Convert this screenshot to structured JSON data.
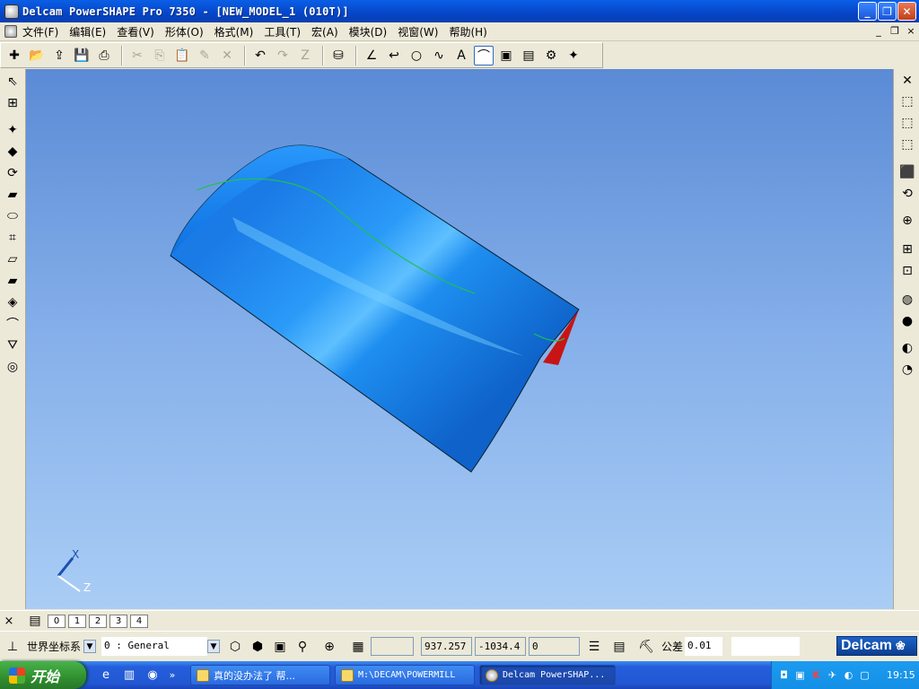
{
  "window": {
    "title": "Delcam PowerSHAPE Pro 7350 - [NEW_MODEL_1 (010T)]",
    "minimize_glyph": "_",
    "maximize_glyph": "❐",
    "close_glyph": "✕"
  },
  "menu": {
    "items": [
      "文件(F)",
      "编辑(E)",
      "查看(V)",
      "形体(O)",
      "格式(M)",
      "工具(T)",
      "宏(A)",
      "模块(D)",
      "视窗(W)",
      "帮助(H)"
    ],
    "mdi_minimize": "_",
    "mdi_restore": "❐",
    "mdi_close": "×"
  },
  "toolbar": {
    "buttons": [
      {
        "icon": "new-icon",
        "glyph": "✚"
      },
      {
        "icon": "open-icon",
        "glyph": "📂"
      },
      {
        "icon": "import-icon",
        "glyph": "⇪"
      },
      {
        "icon": "save-icon",
        "glyph": "💾"
      },
      {
        "icon": "print-icon",
        "glyph": "⎙"
      },
      {
        "icon": "cut-icon",
        "glyph": "✂",
        "dim": true
      },
      {
        "icon": "copy-icon",
        "glyph": "⎘",
        "dim": true
      },
      {
        "icon": "paste-icon",
        "glyph": "📋",
        "dim": true
      },
      {
        "icon": "delete-icon",
        "glyph": "✎",
        "dim": true
      },
      {
        "icon": "clear-icon",
        "glyph": "✕",
        "dim": true
      },
      {
        "icon": "undo-icon",
        "glyph": "↶"
      },
      {
        "icon": "redo-icon",
        "glyph": "↷",
        "dim": true
      },
      {
        "icon": "sketch-icon",
        "glyph": "Z",
        "dim": true
      },
      {
        "icon": "selection-icon",
        "glyph": "⛁"
      },
      {
        "icon": "line-icon",
        "glyph": "∠"
      },
      {
        "icon": "arc-icon",
        "glyph": "↩"
      },
      {
        "icon": "circle-icon",
        "glyph": "○"
      },
      {
        "icon": "curve-icon",
        "glyph": "∿"
      },
      {
        "icon": "text-icon",
        "glyph": "A"
      },
      {
        "icon": "surface-icon",
        "glyph": "⌒",
        "active": true
      },
      {
        "icon": "solid-icon",
        "glyph": "▣"
      },
      {
        "icon": "layers-icon",
        "glyph": "▤"
      },
      {
        "icon": "settings-icon",
        "glyph": "⚙"
      },
      {
        "icon": "wizard-icon",
        "glyph": "✦"
      }
    ]
  },
  "left_tools": [
    "select-icon",
    "multi-select-icon",
    "point-icon",
    "plane-icon",
    "arc-tool-icon",
    "surface-tool-icon",
    "ellipse-icon",
    "mesh-icon",
    "extrude-icon",
    "prism-icon",
    "rotate-icon",
    "spine-icon",
    "drive-icon",
    "dimension-icon"
  ],
  "right_tools": [
    "close-panel-icon",
    "view-top-icon",
    "view-front-icon",
    "view-right-icon",
    "view-iso-icon",
    "view-rotate-icon",
    "zoom-icon",
    "zoom-window-icon",
    "zoom-fit-icon",
    "wireframe-icon",
    "shaded-icon",
    "lighting-icon",
    "material-icon"
  ],
  "model": {
    "surface_color": "#1e8ef0",
    "highlight_color": "#7ad0ff",
    "inner_color": "#c81414",
    "feature_line_color": "#20c050"
  },
  "axis": {
    "x_label": "X",
    "z_label": "Z"
  },
  "levels": {
    "close_glyph": "×",
    "tabs": [
      "0",
      "1",
      "2",
      "3",
      "4"
    ]
  },
  "status": {
    "workplane": "世界坐标系",
    "level": "0    : General",
    "input_blank": "",
    "x_value": "937.257",
    "y_value": "-1034.4",
    "z_value": "0",
    "tolerance_label": "公差",
    "tolerance_value": "0.01",
    "brand": "Delcam"
  },
  "taskbar": {
    "start_label": "开始",
    "chevron": "»",
    "tasks": [
      {
        "label": "真的没办法了 帮...",
        "active": false
      },
      {
        "label": "M:\\DECAM\\POWERMILL",
        "active": false
      },
      {
        "label": "Delcam PowerSHAP...",
        "active": true
      }
    ],
    "clock": "19:15"
  }
}
